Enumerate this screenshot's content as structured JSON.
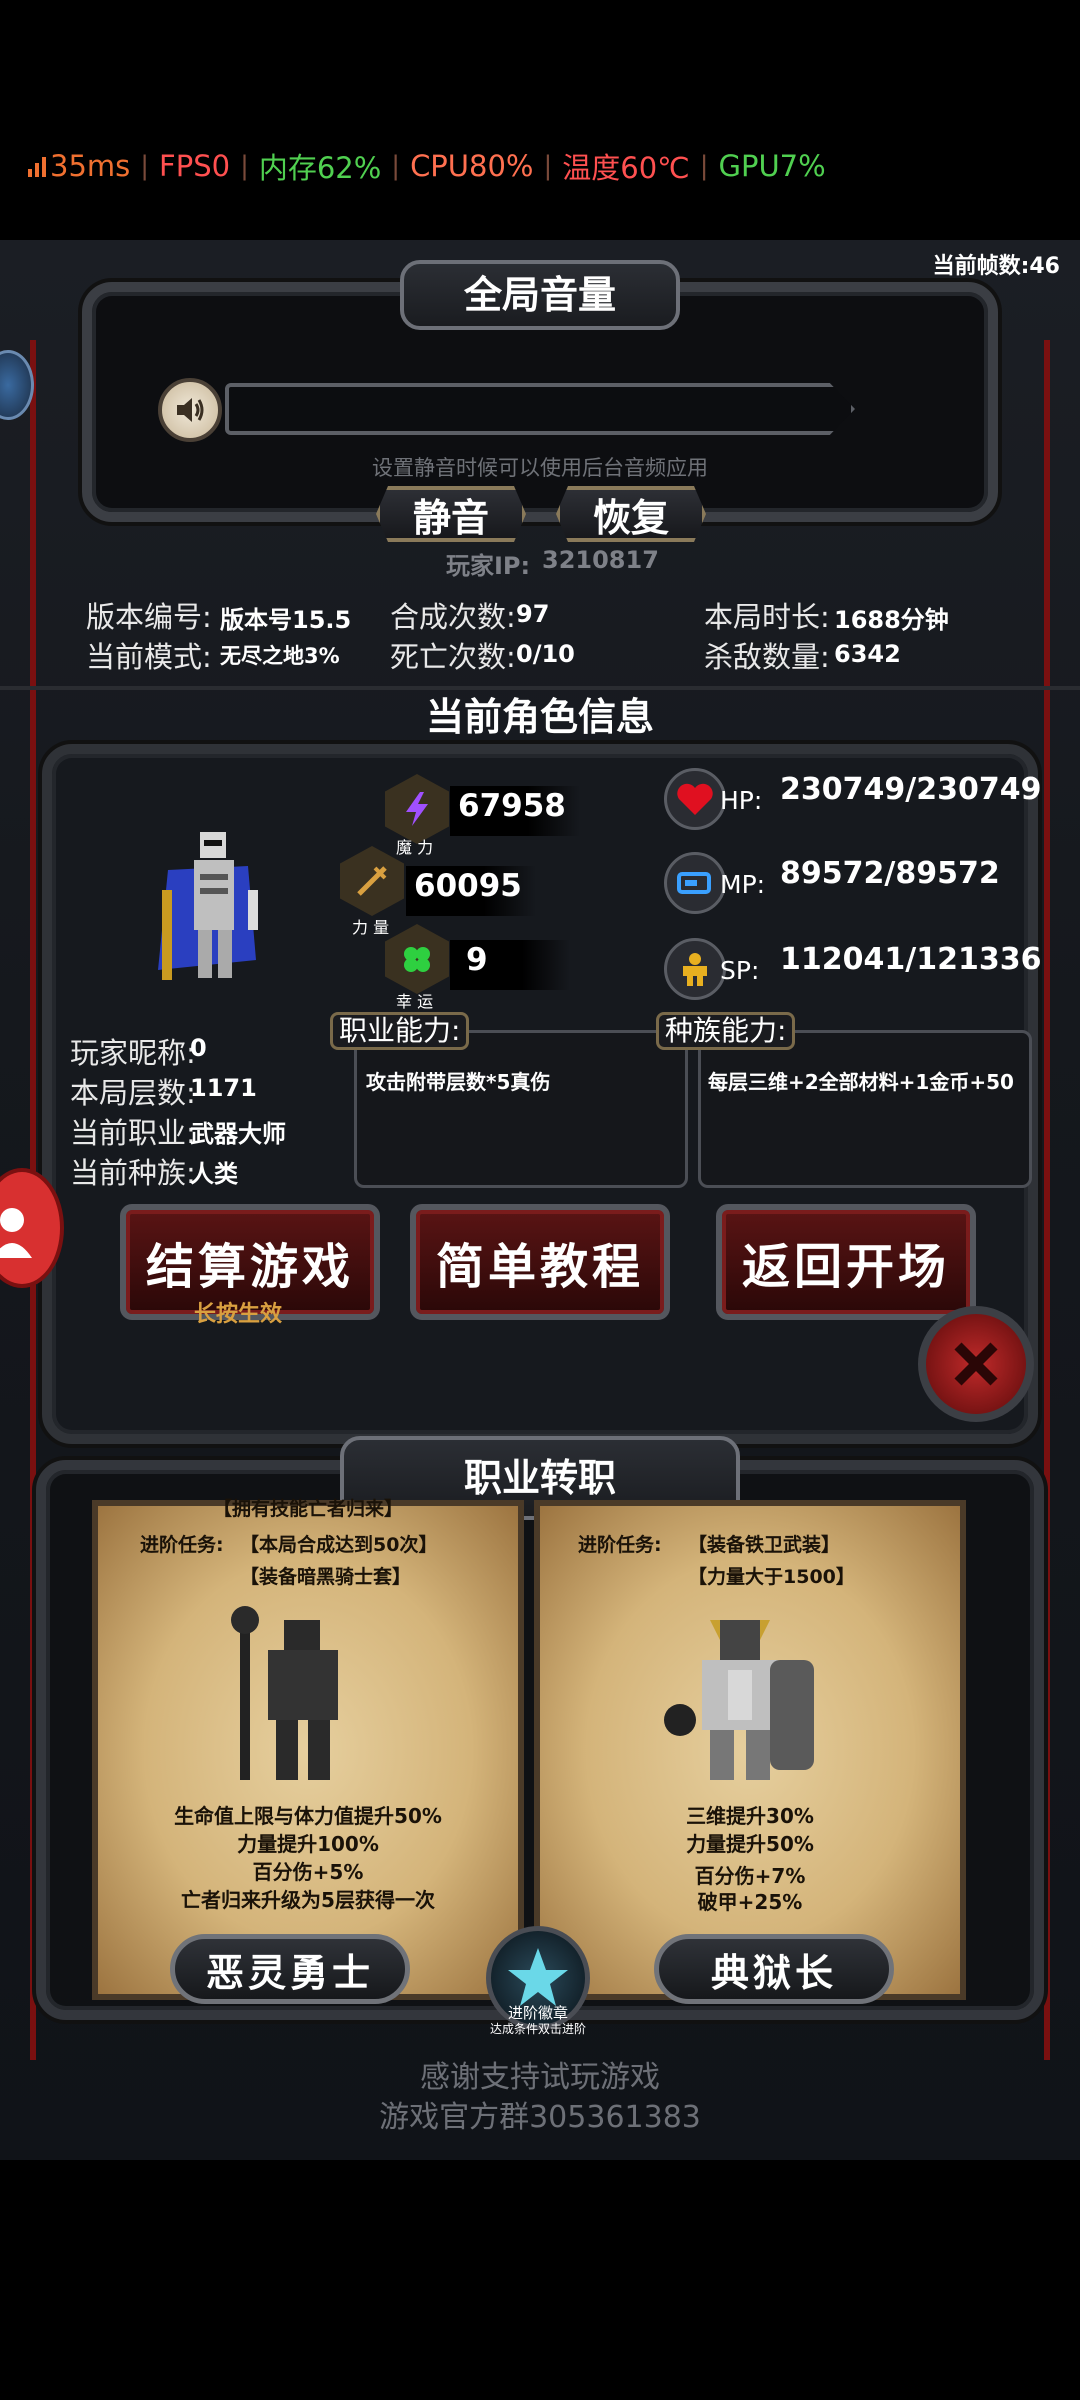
{
  "status_bar": {
    "ping": "35ms",
    "fps": "FPS0",
    "memory": "内存62%",
    "cpu": "CPU80%",
    "temp": "温度60℃",
    "gpu": "GPU7%",
    "colors": {
      "ping": "#f07030",
      "fps": "#ff5050",
      "memory": "#50d050",
      "cpu": "#ff7050",
      "temp": "#ff5050",
      "gpu": "#50d050"
    }
  },
  "frame_counter": "当前帧数:46",
  "volume": {
    "title": "全局音量",
    "hint": "设置静音时候可以使用后台音频应用",
    "mute_label": "静音",
    "restore_label": "恢复"
  },
  "player_ip": {
    "label": "玩家IP:",
    "value": "3210817"
  },
  "stats": {
    "version_label": "版本编号:",
    "version_value": "版本号15.5",
    "mode_label": "当前模式:",
    "mode_value": "无尽之地3%",
    "craft_label": "合成次数:",
    "craft_value": "97",
    "death_label": "死亡次数:",
    "death_value": "0/10",
    "time_label": "本局时长:",
    "time_value": "1688分钟",
    "kills_label": "杀敌数量:",
    "kills_value": "6342"
  },
  "character": {
    "section_title": "当前角色信息",
    "magic": {
      "value": "67958",
      "label": "魔 力"
    },
    "strength": {
      "value": "60095",
      "label": "力 量"
    },
    "luck": {
      "value": "9",
      "label": "幸 运"
    },
    "hp": {
      "label": "HP:",
      "value": "230749/230749"
    },
    "mp": {
      "label": "MP:",
      "value": "89572/89572"
    },
    "sp": {
      "label": "SP:",
      "value": "112041/121336"
    },
    "nickname_label": "玩家昵称:",
    "nickname_value": "0",
    "floors_label": "本局层数:",
    "floors_value": "1171",
    "job_label": "当前职业:",
    "job_value": "武器大师",
    "race_label": "当前种族:",
    "race_value": "人类",
    "job_ability_title": "职业能力:",
    "job_ability_text": "攻击附带层数*5真伤",
    "race_ability_title": "种族能力:",
    "race_ability_text": "每层三维+2全部材料+1金币+50"
  },
  "buttons": {
    "settle": "结算游戏",
    "settle_hint": "长按生效",
    "tutorial": "简单教程",
    "return": "返回开场"
  },
  "job_change": {
    "title": "职业转职",
    "left": {
      "owned": "【拥有技能亡者归来】",
      "task_label": "进阶任务:",
      "task1": "【本局合成达到50次】",
      "task2": "【装备暗黑骑士套】",
      "bonus1": "生命值上限与体力值提升50%",
      "bonus2": "力量提升100%",
      "bonus3": "百分伤+5%",
      "bonus4": "亡者归来升级为5层获得一次",
      "name": "恶灵勇士"
    },
    "right": {
      "task_label": "进阶任务:",
      "task1": "【装备铁卫武装】",
      "task2": "【力量大于1500】",
      "bonus1": "三维提升30%",
      "bonus2": "力量提升50%",
      "bonus3": "百分伤+7%",
      "bonus4": "破甲+25%",
      "name": "典狱长"
    },
    "badge_label": "进阶徽章",
    "badge_hint": "达成条件双击进阶"
  },
  "footer": {
    "thanks": "感谢支持试玩游戏",
    "group": "游戏官方群305361383"
  }
}
